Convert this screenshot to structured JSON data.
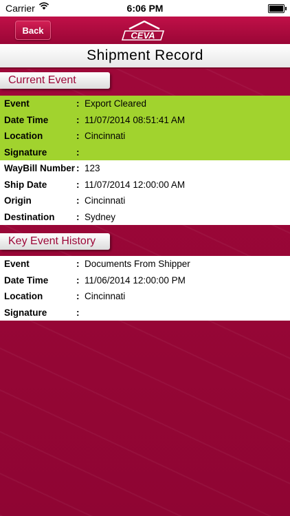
{
  "status_bar": {
    "carrier": "Carrier",
    "time": "6:06 PM"
  },
  "nav": {
    "back_label": "Back",
    "logo_text": "CEVA"
  },
  "page_title": "Shipment Record",
  "current_event": {
    "header": "Current Event",
    "event_rows": [
      {
        "label": "Event",
        "value": "Export Cleared"
      },
      {
        "label": "Date Time",
        "value": "11/07/2014 08:51:41 AM"
      },
      {
        "label": "Location",
        "value": "Cincinnati"
      },
      {
        "label": "Signature",
        "value": ""
      }
    ],
    "shipment_rows": [
      {
        "label": "WayBill Number",
        "value": "123"
      },
      {
        "label": "Ship Date",
        "value": "11/07/2014 12:00:00 AM"
      },
      {
        "label": "Origin",
        "value": "Cincinnati"
      },
      {
        "label": "Destination",
        "value": "Sydney"
      }
    ]
  },
  "key_event_history": {
    "header": "Key Event History",
    "rows": [
      {
        "label": "Event",
        "value": "Documents From Shipper"
      },
      {
        "label": "Date Time",
        "value": "11/06/2014 12:00:00 PM"
      },
      {
        "label": "Location",
        "value": "Cincinnati"
      },
      {
        "label": "Signature",
        "value": ""
      }
    ]
  },
  "colors": {
    "brand": "#9c0738",
    "highlight": "#a1d32e"
  },
  "separator": ":"
}
